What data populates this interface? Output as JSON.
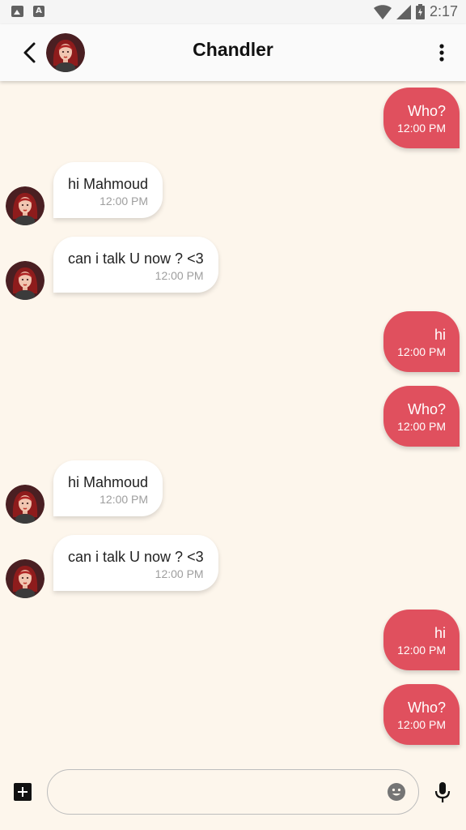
{
  "status_bar": {
    "time": "2:17",
    "left_icons": [
      "image-icon",
      "a-icon"
    ],
    "right_icons": [
      "wifi-icon",
      "signal-icon",
      "battery-icon"
    ],
    "a_glyph": "A"
  },
  "header": {
    "title": "Chandler",
    "back_icon": "chevron-left-icon",
    "menu_icon": "more-vert-icon"
  },
  "messages": [
    {
      "direction": "out",
      "text": "Who?",
      "time": "12:00 PM"
    },
    {
      "direction": "in",
      "text": "hi Mahmoud",
      "time": "12:00 PM"
    },
    {
      "direction": "in",
      "text": "can i talk U now ? <3",
      "time": "12:00 PM"
    },
    {
      "direction": "out",
      "text": "hi",
      "time": "12:00 PM"
    },
    {
      "direction": "out",
      "text": "Who?",
      "time": "12:00 PM"
    },
    {
      "direction": "in",
      "text": "hi Mahmoud",
      "time": "12:00 PM"
    },
    {
      "direction": "in",
      "text": "can i talk U now ? <3",
      "time": "12:00 PM"
    },
    {
      "direction": "out",
      "text": "hi",
      "time": "12:00 PM"
    },
    {
      "direction": "out",
      "text": "Who?",
      "time": "12:00 PM"
    }
  ],
  "composer": {
    "placeholder": "",
    "value": "",
    "attach_icon": "add-box-icon",
    "emoji_icon": "emoji-icon",
    "mic_icon": "mic-icon"
  },
  "colors": {
    "background": "#fdf6ec",
    "outgoing_bubble": "#e0505e",
    "incoming_bubble": "#ffffff"
  }
}
